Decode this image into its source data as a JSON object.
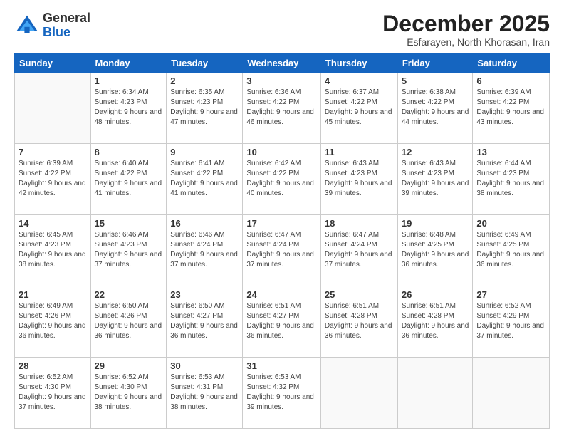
{
  "logo": {
    "general": "General",
    "blue": "Blue"
  },
  "header": {
    "month": "December 2025",
    "location": "Esfarayen, North Khorasan, Iran"
  },
  "weekdays": [
    "Sunday",
    "Monday",
    "Tuesday",
    "Wednesday",
    "Thursday",
    "Friday",
    "Saturday"
  ],
  "weeks": [
    [
      {
        "day": "",
        "sunrise": "",
        "sunset": "",
        "daylight": "",
        "empty": true
      },
      {
        "day": "1",
        "sunrise": "6:34 AM",
        "sunset": "4:23 PM",
        "daylight": "9 hours and 48 minutes."
      },
      {
        "day": "2",
        "sunrise": "6:35 AM",
        "sunset": "4:23 PM",
        "daylight": "9 hours and 47 minutes."
      },
      {
        "day": "3",
        "sunrise": "6:36 AM",
        "sunset": "4:22 PM",
        "daylight": "9 hours and 46 minutes."
      },
      {
        "day": "4",
        "sunrise": "6:37 AM",
        "sunset": "4:22 PM",
        "daylight": "9 hours and 45 minutes."
      },
      {
        "day": "5",
        "sunrise": "6:38 AM",
        "sunset": "4:22 PM",
        "daylight": "9 hours and 44 minutes."
      },
      {
        "day": "6",
        "sunrise": "6:39 AM",
        "sunset": "4:22 PM",
        "daylight": "9 hours and 43 minutes."
      }
    ],
    [
      {
        "day": "7",
        "sunrise": "6:39 AM",
        "sunset": "4:22 PM",
        "daylight": "9 hours and 42 minutes."
      },
      {
        "day": "8",
        "sunrise": "6:40 AM",
        "sunset": "4:22 PM",
        "daylight": "9 hours and 41 minutes."
      },
      {
        "day": "9",
        "sunrise": "6:41 AM",
        "sunset": "4:22 PM",
        "daylight": "9 hours and 41 minutes."
      },
      {
        "day": "10",
        "sunrise": "6:42 AM",
        "sunset": "4:22 PM",
        "daylight": "9 hours and 40 minutes."
      },
      {
        "day": "11",
        "sunrise": "6:43 AM",
        "sunset": "4:23 PM",
        "daylight": "9 hours and 39 minutes."
      },
      {
        "day": "12",
        "sunrise": "6:43 AM",
        "sunset": "4:23 PM",
        "daylight": "9 hours and 39 minutes."
      },
      {
        "day": "13",
        "sunrise": "6:44 AM",
        "sunset": "4:23 PM",
        "daylight": "9 hours and 38 minutes."
      }
    ],
    [
      {
        "day": "14",
        "sunrise": "6:45 AM",
        "sunset": "4:23 PM",
        "daylight": "9 hours and 38 minutes."
      },
      {
        "day": "15",
        "sunrise": "6:46 AM",
        "sunset": "4:23 PM",
        "daylight": "9 hours and 37 minutes."
      },
      {
        "day": "16",
        "sunrise": "6:46 AM",
        "sunset": "4:24 PM",
        "daylight": "9 hours and 37 minutes."
      },
      {
        "day": "17",
        "sunrise": "6:47 AM",
        "sunset": "4:24 PM",
        "daylight": "9 hours and 37 minutes."
      },
      {
        "day": "18",
        "sunrise": "6:47 AM",
        "sunset": "4:24 PM",
        "daylight": "9 hours and 37 minutes."
      },
      {
        "day": "19",
        "sunrise": "6:48 AM",
        "sunset": "4:25 PM",
        "daylight": "9 hours and 36 minutes."
      },
      {
        "day": "20",
        "sunrise": "6:49 AM",
        "sunset": "4:25 PM",
        "daylight": "9 hours and 36 minutes."
      }
    ],
    [
      {
        "day": "21",
        "sunrise": "6:49 AM",
        "sunset": "4:26 PM",
        "daylight": "9 hours and 36 minutes."
      },
      {
        "day": "22",
        "sunrise": "6:50 AM",
        "sunset": "4:26 PM",
        "daylight": "9 hours and 36 minutes."
      },
      {
        "day": "23",
        "sunrise": "6:50 AM",
        "sunset": "4:27 PM",
        "daylight": "9 hours and 36 minutes."
      },
      {
        "day": "24",
        "sunrise": "6:51 AM",
        "sunset": "4:27 PM",
        "daylight": "9 hours and 36 minutes."
      },
      {
        "day": "25",
        "sunrise": "6:51 AM",
        "sunset": "4:28 PM",
        "daylight": "9 hours and 36 minutes."
      },
      {
        "day": "26",
        "sunrise": "6:51 AM",
        "sunset": "4:28 PM",
        "daylight": "9 hours and 36 minutes."
      },
      {
        "day": "27",
        "sunrise": "6:52 AM",
        "sunset": "4:29 PM",
        "daylight": "9 hours and 37 minutes."
      }
    ],
    [
      {
        "day": "28",
        "sunrise": "6:52 AM",
        "sunset": "4:30 PM",
        "daylight": "9 hours and 37 minutes."
      },
      {
        "day": "29",
        "sunrise": "6:52 AM",
        "sunset": "4:30 PM",
        "daylight": "9 hours and 38 minutes."
      },
      {
        "day": "30",
        "sunrise": "6:53 AM",
        "sunset": "4:31 PM",
        "daylight": "9 hours and 38 minutes."
      },
      {
        "day": "31",
        "sunrise": "6:53 AM",
        "sunset": "4:32 PM",
        "daylight": "9 hours and 39 minutes."
      },
      {
        "day": "",
        "sunrise": "",
        "sunset": "",
        "daylight": "",
        "empty": true
      },
      {
        "day": "",
        "sunrise": "",
        "sunset": "",
        "daylight": "",
        "empty": true
      },
      {
        "day": "",
        "sunrise": "",
        "sunset": "",
        "daylight": "",
        "empty": true
      }
    ]
  ],
  "labels": {
    "sunrise_prefix": "Sunrise: ",
    "sunset_prefix": "Sunset: ",
    "daylight_prefix": "Daylight: "
  }
}
